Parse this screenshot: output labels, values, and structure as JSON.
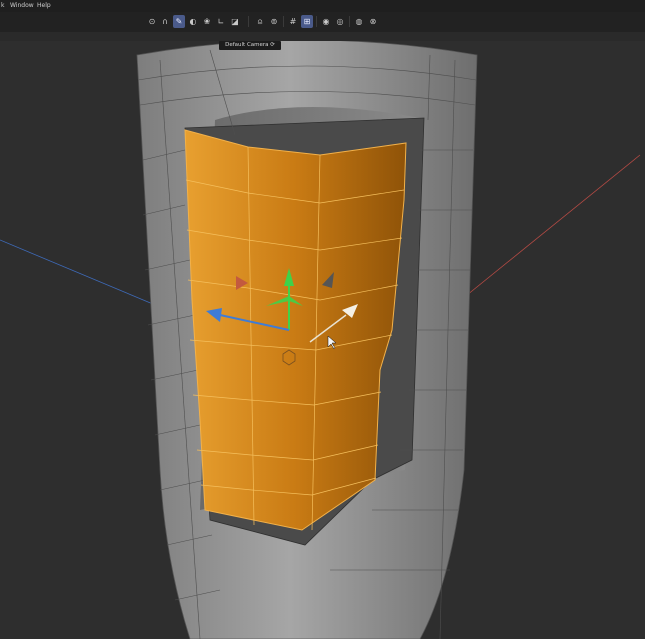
{
  "menu": {
    "items": [
      "Window",
      "Help"
    ]
  },
  "toolbar": {
    "buttons": [
      {
        "name": "live-selection-icon",
        "glyph": "⊙"
      },
      {
        "name": "magnet-icon",
        "glyph": "∩"
      },
      {
        "name": "polygon-pen-icon",
        "glyph": "✎",
        "active": true
      },
      {
        "name": "sculpt-icon",
        "glyph": "◐"
      },
      {
        "name": "paint-icon",
        "glyph": "❀"
      },
      {
        "name": "axis-icon",
        "glyph": "∟"
      },
      {
        "name": "checker-icon",
        "glyph": "◪"
      },
      {
        "name": "lock-icon",
        "glyph": "⍝"
      },
      {
        "name": "snap-icon",
        "glyph": "⊚"
      },
      {
        "name": "grid-icon",
        "glyph": "#"
      },
      {
        "name": "grid-snap-icon",
        "glyph": "⊞",
        "active": true
      },
      {
        "name": "render-region-icon",
        "glyph": "◉"
      },
      {
        "name": "render-view-icon",
        "glyph": "◎"
      },
      {
        "name": "render-settings-icon",
        "glyph": "◍"
      },
      {
        "name": "display-icon",
        "glyph": "⊗"
      }
    ]
  },
  "viewport": {
    "camera_label": "Default Camera ⟳"
  },
  "colors": {
    "selection": "#e08f1c",
    "axis_x": "#d64a3f",
    "axis_y": "#3fd24a",
    "axis_z": "#3f7cd6",
    "mesh": "#8e8e8e",
    "wire": "#5a5a5a"
  }
}
